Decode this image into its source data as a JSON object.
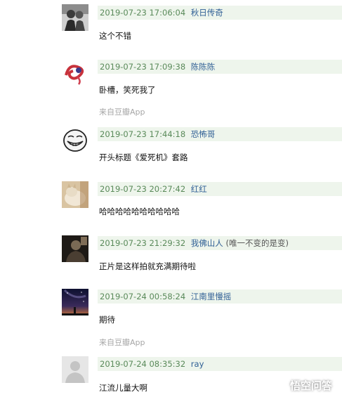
{
  "comments": [
    {
      "time": "2019-07-23 17:06:04",
      "user": "秋日传奇",
      "extra": "",
      "text": "这个不错",
      "source": "",
      "avatar": "grayscale-couple-photo"
    },
    {
      "time": "2019-07-23 17:09:38",
      "user": "陈陈陈",
      "extra": "",
      "text": "卧槽，笑死我了",
      "source": "来自豆瓣App",
      "avatar": "red-ribbon-doodle"
    },
    {
      "time": "2019-07-23 17:44:18",
      "user": "恐怖哥",
      "extra": "",
      "text": "开头标题《爱死机》套路",
      "source": "",
      "avatar": "troll-face-sketch"
    },
    {
      "time": "2019-07-23 20:27:42",
      "user": "红红",
      "extra": "",
      "text": "哈哈哈哈哈哈哈哈哈哈",
      "source": "",
      "avatar": "cat-photo"
    },
    {
      "time": "2019-07-23 21:29:32",
      "user": "我佛山人",
      "extra": "(唯一不变的是变)",
      "text": "正片是这样拍就充满期待啦",
      "source": "",
      "avatar": "dark-portrait"
    },
    {
      "time": "2019-07-24 00:58:24",
      "user": "江南里慢摇",
      "extra": "",
      "text": "期待",
      "source": "来自豆瓣App",
      "avatar": "night-sky-silhouette"
    },
    {
      "time": "2019-07-24 08:35:32",
      "user": "ray",
      "extra": "",
      "text": "江流儿量大啊",
      "source": "",
      "avatar": "default-user-placeholder"
    }
  ],
  "watermark": {
    "text": "悟空问答",
    "icon": "wukong-logo"
  }
}
